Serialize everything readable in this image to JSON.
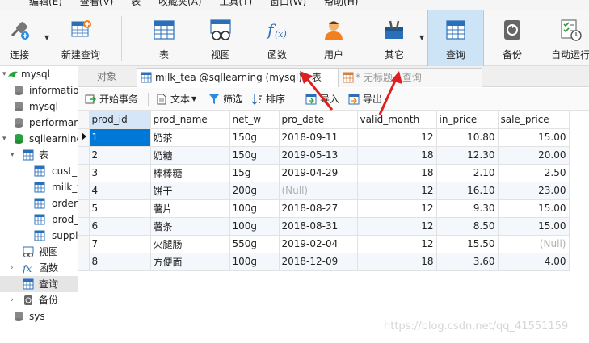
{
  "menu": [
    "编辑(E)",
    "查看(V)",
    "表",
    "收藏夹(A)",
    "工具(T)",
    "窗口(W)",
    "帮助(H)"
  ],
  "ribbon": {
    "connect": "连接",
    "new_query": "新建查询",
    "table": "表",
    "view": "视图",
    "function": "函数",
    "user": "用户",
    "other": "其它",
    "query": "查询",
    "backup": "备份",
    "auto_run": "自动运行"
  },
  "sidebar": {
    "conn": "mysql",
    "dbs": [
      "information_schema",
      "mysql",
      "performance_schema",
      "sqllearning"
    ],
    "tables_group": "表",
    "tables": [
      "cust_info",
      "milk_tea",
      "order",
      "prod_info",
      "supplier"
    ],
    "views": "视图",
    "functions": "函数",
    "queries": "查询",
    "backup": "备份",
    "sys": "sys"
  },
  "tabs": {
    "objects": "对象",
    "active": "milk_tea @sqllearning (mysql) - 表",
    "other": "* 无标题 - 查询"
  },
  "toolbar": {
    "begin_tx": "开始事务",
    "text": "文本",
    "filter": "筛选",
    "sort": "排序",
    "import": "导入",
    "export": "导出"
  },
  "grid": {
    "columns": [
      "prod_id",
      "prod_name",
      "net_w",
      "pro_date",
      "valid_month",
      "in_price",
      "sale_price"
    ],
    "rows": [
      [
        "1",
        "奶茶",
        "150g",
        "2018-09-11",
        "12",
        "10.80",
        "15.00"
      ],
      [
        "2",
        "奶糖",
        "150g",
        "2019-05-13",
        "18",
        "12.30",
        "20.00"
      ],
      [
        "3",
        "棒棒糖",
        "15g",
        "2019-04-29",
        "18",
        "2.10",
        "2.50"
      ],
      [
        "4",
        "饼干",
        "200g",
        "(Null)",
        "12",
        "16.10",
        "23.00"
      ],
      [
        "5",
        "薯片",
        "100g",
        "2018-08-27",
        "12",
        "9.30",
        "15.00"
      ],
      [
        "6",
        "薯条",
        "100g",
        "2018-08-31",
        "12",
        "8.50",
        "15.00"
      ],
      [
        "7",
        "火腿肠",
        "550g",
        "2019-02-04",
        "12",
        "15.50",
        "(Null)"
      ],
      [
        "8",
        "方便面",
        "100g",
        "2018-12-09",
        "18",
        "3.60",
        "4.00"
      ]
    ]
  },
  "watermark": "https://blog.csdn.net/qq_41551159",
  "colors": {
    "accent": "#0078d7",
    "active_ribbon": "#cde4f7",
    "arrow": "#e02020",
    "null": "#b0b0b0"
  }
}
